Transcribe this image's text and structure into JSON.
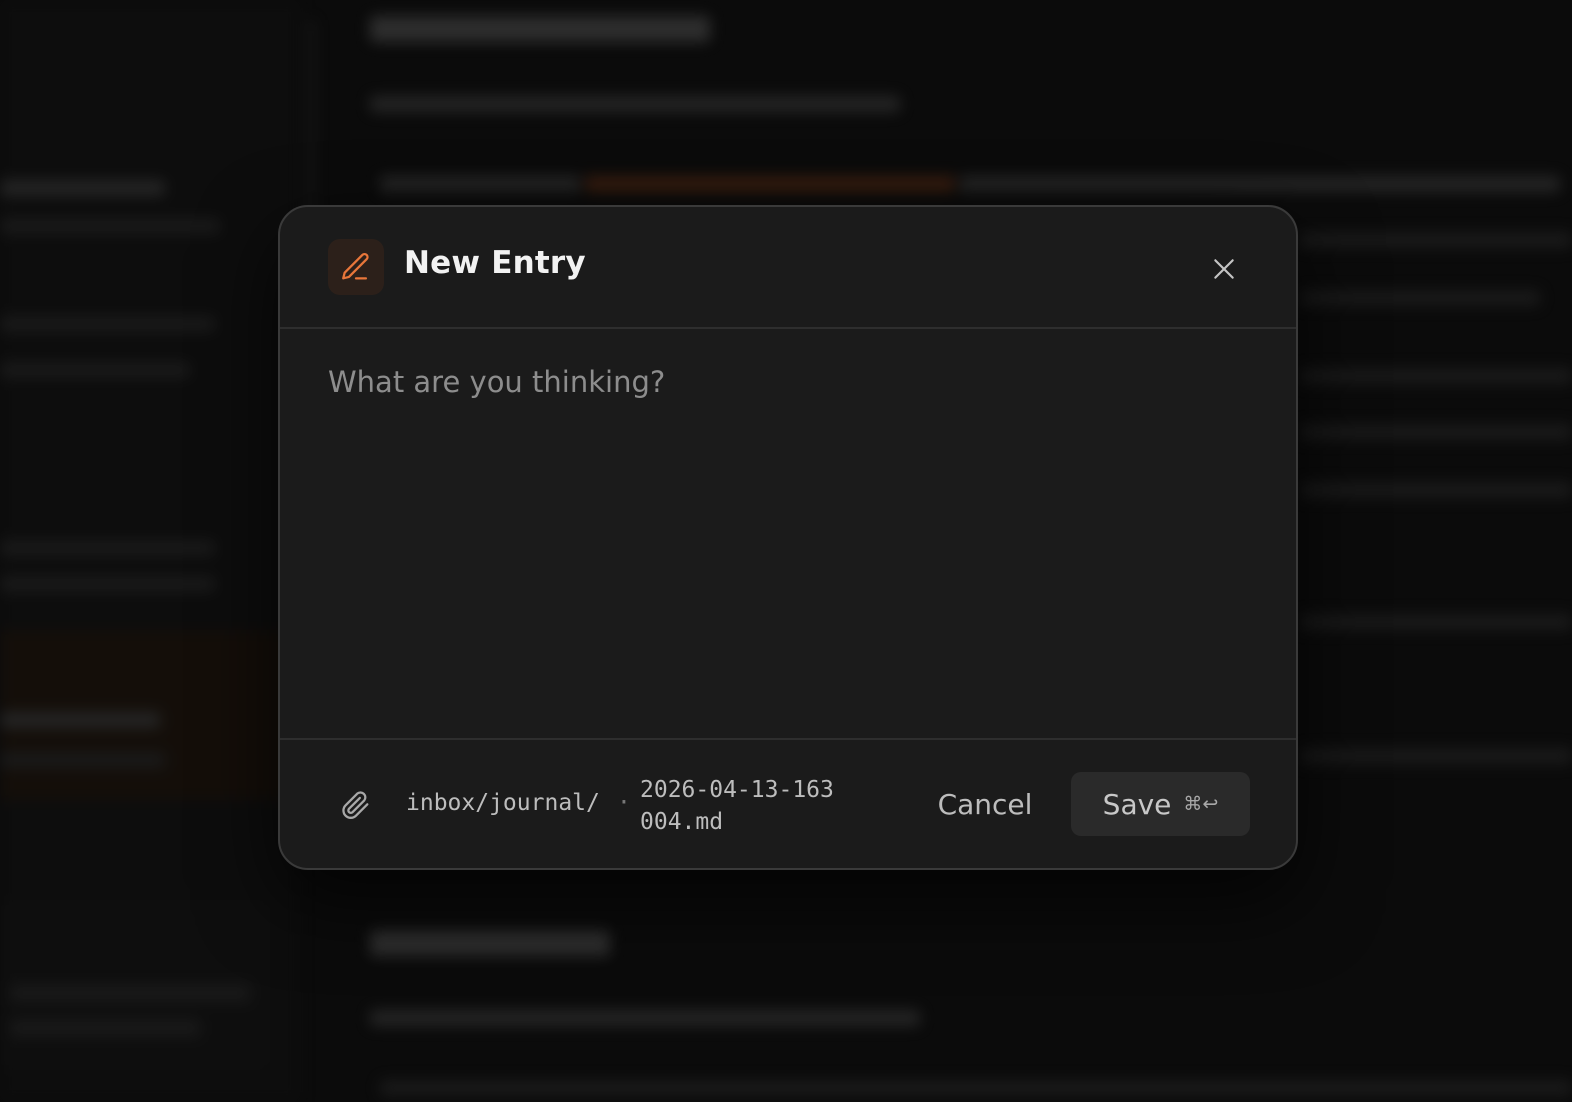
{
  "modal": {
    "title": "New Entry",
    "header_icon": "pencil-icon",
    "close_icon": "close-icon",
    "input": {
      "placeholder": "What are you thinking?",
      "value": ""
    },
    "footer": {
      "attach_icon": "paperclip-icon",
      "path_prefix": "inbox/journal/",
      "path_separator": "·",
      "filename": "2026-04-13-163004.md",
      "cancel_label": "Cancel",
      "save_label": "Save",
      "save_shortcut": "⌘↩"
    },
    "accent_color": "#e8763a"
  }
}
